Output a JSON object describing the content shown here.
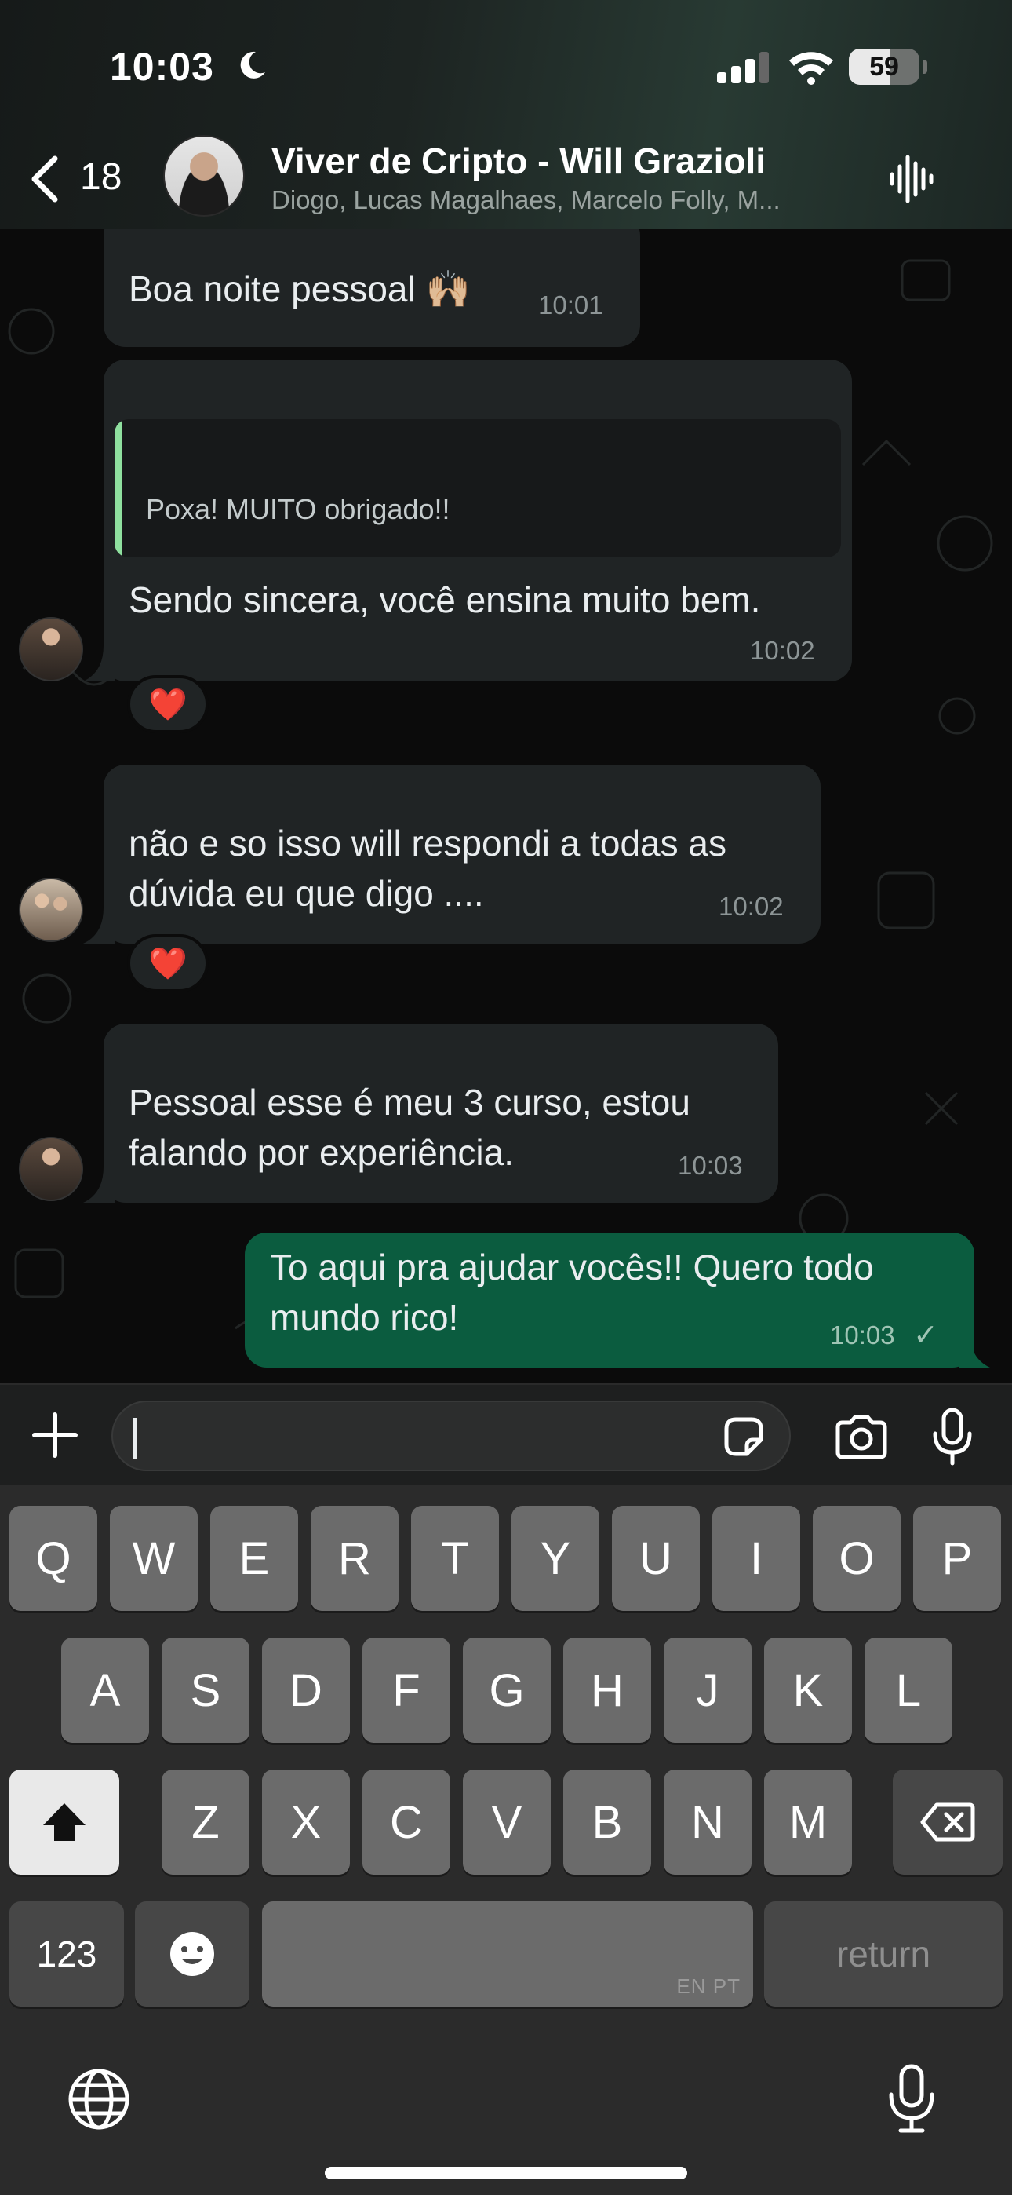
{
  "status_bar": {
    "time": "10:03",
    "battery": "59",
    "battery_level": 0.59
  },
  "header": {
    "back_count": "18",
    "title": "Viver de Cripto - Will Grazioli",
    "members": "Diogo, Lucas Magalhaes, Marcelo Folly, M..."
  },
  "messages": [
    {
      "text": "Boa noite pessoal 🙌🏼",
      "time": "10:01"
    },
    {
      "quote": "Poxa! MUITO obrigado!!",
      "text": "Sendo sincera, você ensina muito bem.",
      "time": "10:02",
      "reaction": "❤️"
    },
    {
      "text_line1": "não e so isso will respondi a todas as",
      "text_line2": "dúvida eu que digo ....",
      "time": "10:02",
      "reaction": "❤️"
    },
    {
      "text_line1": "Pessoal esse é meu 3 curso, estou",
      "text_line2": "falando por experiência.",
      "time": "10:03"
    },
    {
      "text_line1": "To aqui pra ajudar vocês!! Quero todo",
      "text_line2": "mundo rico!",
      "time": "10:03",
      "status": "✓"
    }
  ],
  "keyboard": {
    "row1": [
      "Q",
      "W",
      "E",
      "R",
      "T",
      "Y",
      "U",
      "I",
      "O",
      "P"
    ],
    "row2": [
      "A",
      "S",
      "D",
      "F",
      "G",
      "H",
      "J",
      "K",
      "L"
    ],
    "row3": [
      "Z",
      "X",
      "C",
      "V",
      "B",
      "N",
      "M"
    ],
    "numbers_key": "123",
    "emoji_key": "☻",
    "space_lang": "EN PT",
    "return_key": "return"
  },
  "colors": {
    "outgoing_bubble": "#0b5c3f",
    "incoming_bubble": "#202425",
    "quote_bar": "#8fe09f"
  }
}
